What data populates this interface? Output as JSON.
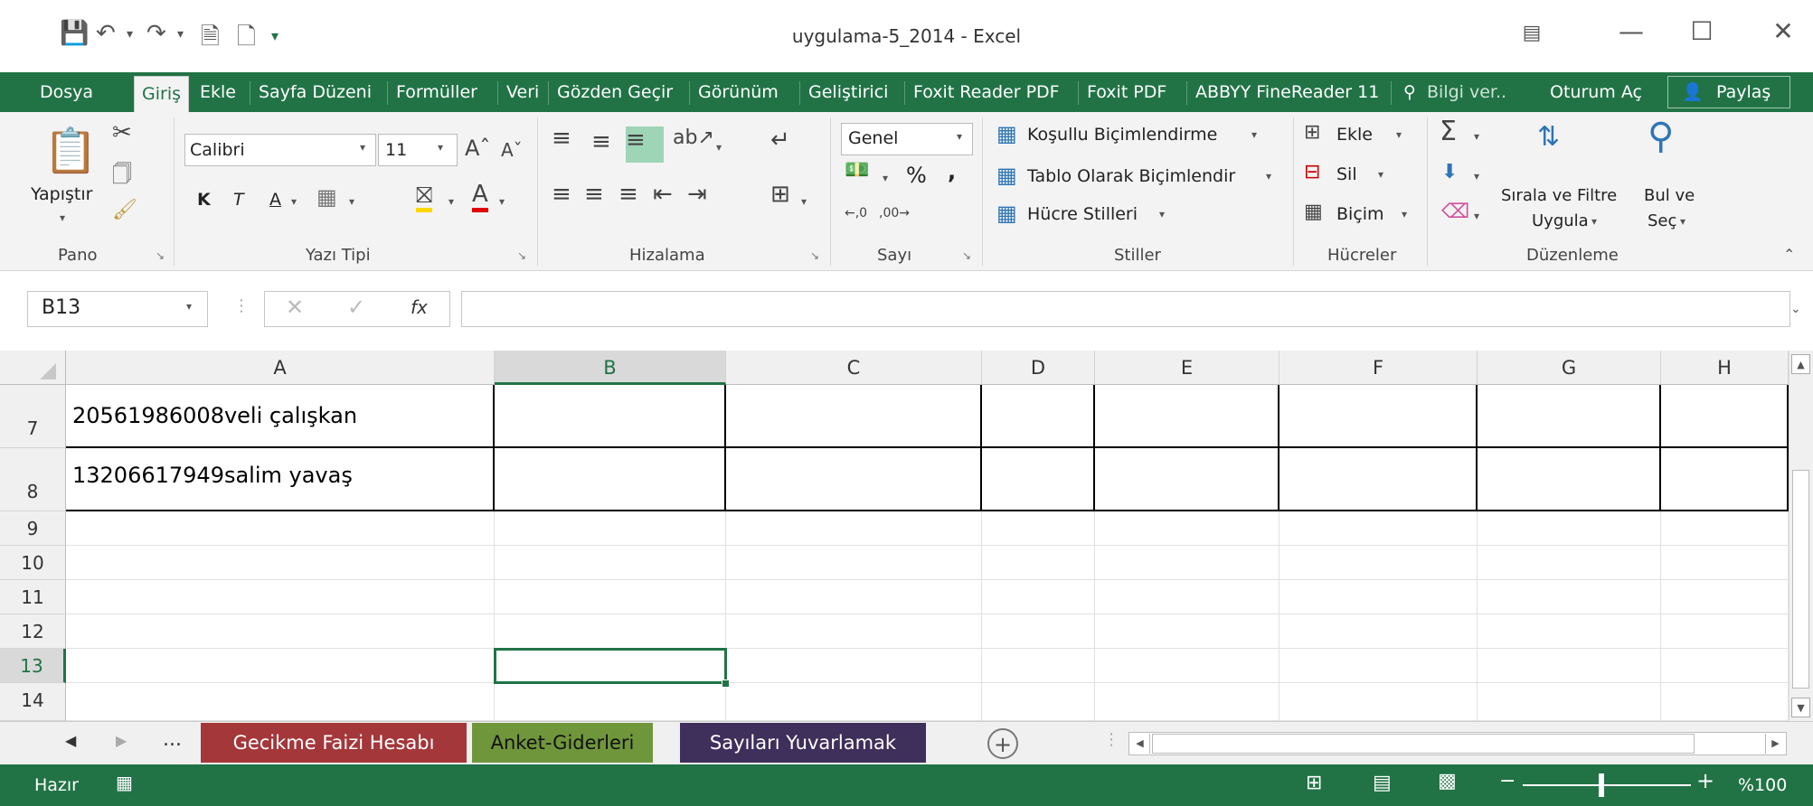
{
  "title_bar": {
    "title": "uygulama-5_2014 - Excel"
  },
  "ribbon_tabs": [
    "Dosya",
    "Giriş",
    "Ekle",
    "Sayfa Düzeni",
    "Formüller",
    "Veri",
    "Gözden Geçir",
    "Görünüm",
    "Geliştirici",
    "Foxit Reader PDF",
    "Foxit PDF",
    "ABBYY FineReader 11"
  ],
  "ribbon_right": {
    "tell_me": "Bilgi ver..",
    "sign_in": "Oturum Aç",
    "share": "Paylaş"
  },
  "ribbon": {
    "clipboard": {
      "paste": "Yapıştır",
      "group": "Pano"
    },
    "font": {
      "name": "Calibri",
      "size": "11",
      "bold": "K",
      "italic": "T",
      "underline": "A",
      "group": "Yazı Tipi"
    },
    "alignment": {
      "group": "Hizalama"
    },
    "number": {
      "format": "Genel",
      "percent": "%",
      "comma": ",",
      "group": "Sayı"
    },
    "styles": {
      "conditional": "Koşullu Biçimlendirme",
      "as_table": "Tablo Olarak Biçimlendir",
      "cell_styles": "Hücre Stilleri",
      "group": "Stiller"
    },
    "cells": {
      "insert": "Ekle",
      "delete": "Sil",
      "format": "Biçim",
      "group": "Hücreler"
    },
    "editing": {
      "sort_line1": "Sırala ve Filtre",
      "sort_line2": "Uygula",
      "find_line1": "Bul ve",
      "find_line2": "Seç",
      "group": "Düzenleme"
    }
  },
  "formula_bar": {
    "name_box": "B13",
    "fx": "fx",
    "value": ""
  },
  "columns": [
    "A",
    "B",
    "C",
    "D",
    "E",
    "F",
    "G",
    "H"
  ],
  "selected_column": "B",
  "rows": [
    {
      "num": "7",
      "a": "20561986008veli çalışkan"
    },
    {
      "num": "8",
      "a": "13206617949salim yavaş"
    },
    {
      "num": "9",
      "a": ""
    },
    {
      "num": "10",
      "a": ""
    },
    {
      "num": "11",
      "a": ""
    },
    {
      "num": "12",
      "a": ""
    },
    {
      "num": "13",
      "a": ""
    },
    {
      "num": "14",
      "a": ""
    }
  ],
  "active_cell": "B13",
  "sheet_tabs": [
    {
      "label": "Gecikme Faizi Hesabı",
      "color": "#a4373a"
    },
    {
      "label": "Anket-Giderleri",
      "color": "#70963c"
    },
    {
      "label": "Sayıları Yuvarlamak",
      "color": "#3f2f5b"
    }
  ],
  "sheet_nav_more": "...",
  "status": {
    "ready": "Hazır",
    "zoom": "%100"
  },
  "accent_color": "#217346"
}
